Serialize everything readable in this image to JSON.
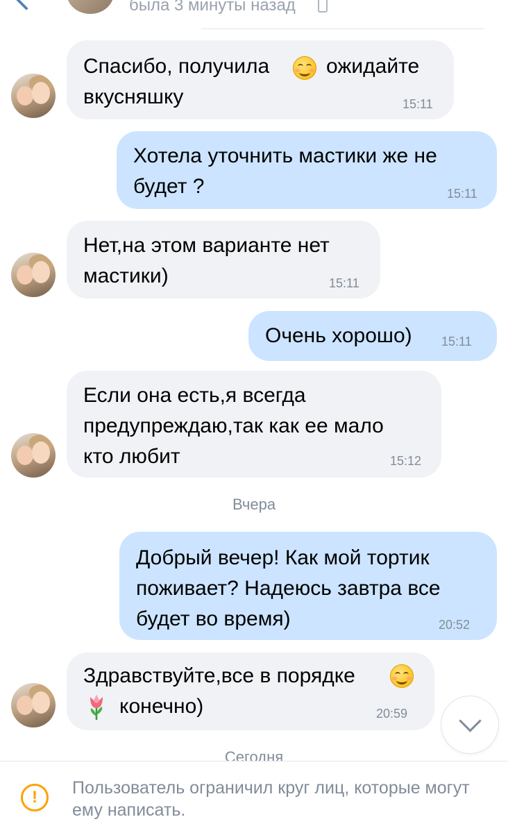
{
  "header": {
    "status": "была 3 минуты назад"
  },
  "messages": [
    {
      "dir": "in",
      "lines": [
        "Спасибо, получила",
        "вкусняшку"
      ],
      "inline_after_line1": "ожидайте",
      "time": "15:11"
    },
    {
      "dir": "out",
      "lines": [
        "Хотела уточнить мастики же не",
        "будет ?"
      ],
      "time": "15:11"
    },
    {
      "dir": "in",
      "lines": [
        "Нет,на этом варианте нет",
        "мастики)"
      ],
      "time": "15:11"
    },
    {
      "dir": "out",
      "lines": [
        "Очень хорошо)"
      ],
      "time": "15:11"
    },
    {
      "dir": "in",
      "lines": [
        "Если она есть,я всегда",
        "предупреждаю,так как ее мало",
        "кто любит"
      ],
      "time": "15:12"
    },
    {
      "dir": "out",
      "lines": [
        "Добрый вечер! Как мой тортик",
        "поживает? Надеюсь завтра все",
        "будет во время)"
      ],
      "time": "20:52"
    },
    {
      "dir": "in",
      "lines": [
        "Здравствуйте,все в порядке",
        "конечно)"
      ],
      "time": "20:59"
    }
  ],
  "separators": {
    "yesterday": "Вчера",
    "today": "Сегодня"
  },
  "icons": {
    "back": "back-arrow-icon",
    "smile": "smiling-face-emoji",
    "tulip": "tulip-emoji",
    "scroll": "chevron-down-icon",
    "warning": "exclamation-circle-icon"
  },
  "footer": {
    "notice": "Пользователь ограничил круг лиц, которые могут ему написать."
  },
  "colors": {
    "incoming_bubble": "#f0f2f5",
    "outgoing_bubble": "#cce4ff",
    "muted_text": "#818c99",
    "warning": "#ffa000",
    "accent": "#5181b8"
  }
}
